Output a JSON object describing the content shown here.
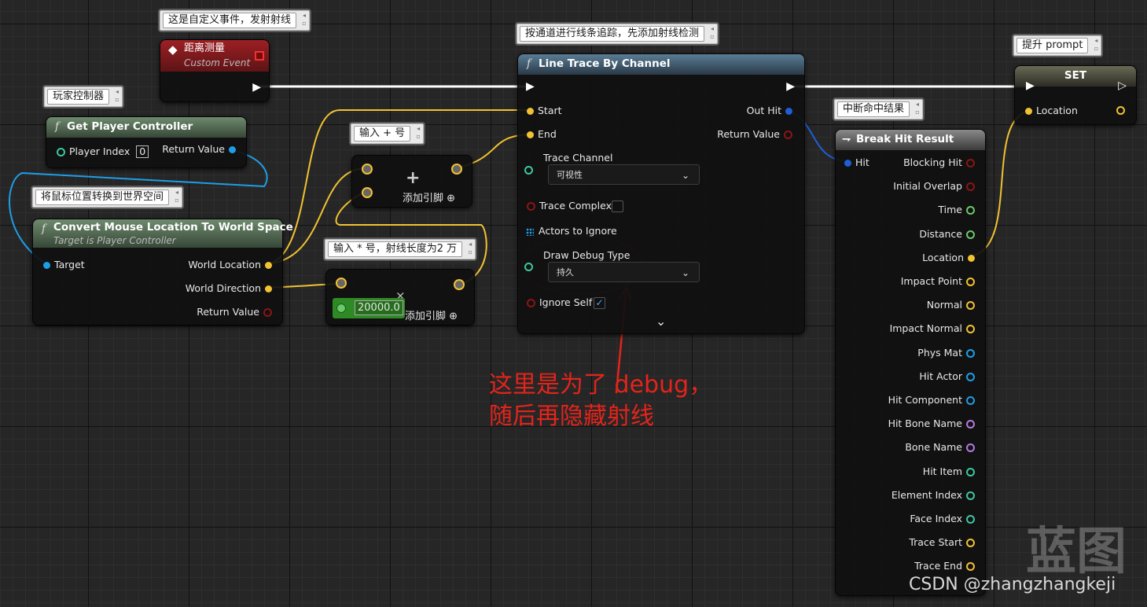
{
  "comments": {
    "custom_event": "这是自定义事件，发射射线",
    "trace": "按通道进行线条追踪，先添加射线检测",
    "set_prompt": "提升 prompt",
    "player_controller": "玩家控制器",
    "break_hit": "中断命中结果",
    "add_plus": "输入 + 号",
    "convert": "将鼠标位置转换到世界空间",
    "multiply": "输入 * 号，射线长度为2 万"
  },
  "custom_event": {
    "title": "距离测量",
    "subtitle": "Custom Event"
  },
  "get_player_controller": {
    "title": "Get Player Controller",
    "player_index_label": "Player Index",
    "player_index_value": "0",
    "return_value": "Return Value"
  },
  "convert_node": {
    "title": "Convert Mouse Location To World Space",
    "subtitle": "Target is Player Controller",
    "target": "Target",
    "world_location": "World Location",
    "world_direction": "World Direction",
    "return_value": "Return Value"
  },
  "add_node": {
    "symbol": "+",
    "add_pin": "添加引脚"
  },
  "multiply_node": {
    "value": "20000.0",
    "add_pin": "添加引脚",
    "clear": "×"
  },
  "line_trace": {
    "title": "Line Trace By Channel",
    "start": "Start",
    "end": "End",
    "out_hit": "Out Hit",
    "return_value": "Return Value",
    "trace_channel": "Trace Channel",
    "trace_channel_value": "可视性",
    "trace_complex": "Trace Complex",
    "actors_to_ignore": "Actors to Ignore",
    "draw_debug_type": "Draw Debug Type",
    "draw_debug_value": "持久",
    "ignore_self": "Ignore Self",
    "expand": "⌄"
  },
  "break_hit": {
    "title": "Break Hit Result",
    "hit": "Hit",
    "outputs": [
      "Blocking Hit",
      "Initial Overlap",
      "Time",
      "Distance",
      "Location",
      "Impact Point",
      "Normal",
      "Impact Normal",
      "Phys Mat",
      "Hit Actor",
      "Hit Component",
      "Hit Bone Name",
      "Bone Name",
      "Hit Item",
      "Element Index",
      "Face Index",
      "Trace Start",
      "Trace End"
    ],
    "output_colors": [
      "#8b1515",
      "#8b1515",
      "#6ac96a",
      "#6ac96a",
      "#f1c232",
      "#f1c232",
      "#f1c232",
      "#f1c232",
      "#1e9ee8",
      "#1e9ee8",
      "#1e9ee8",
      "#b57ae2",
      "#b57ae2",
      "#3cc7a0",
      "#3cc7a0",
      "#3cc7a0",
      "#f1c232",
      "#f1c232"
    ]
  },
  "set_node": {
    "title": "SET",
    "location": "Location"
  },
  "annotation": {
    "line1": "这里是为了 debug，",
    "line2": "随后再隐藏射线"
  },
  "watermark": "蓝图",
  "credit": "CSDN @zhangzhangkeji",
  "colors": {
    "exec": "#ffffff",
    "vector": "#f1c232",
    "object": "#1e9ee8",
    "struct": "#1e5fd6",
    "bool": "#8b1515",
    "float": "#6ac96a",
    "annotation": "#e3241b"
  }
}
